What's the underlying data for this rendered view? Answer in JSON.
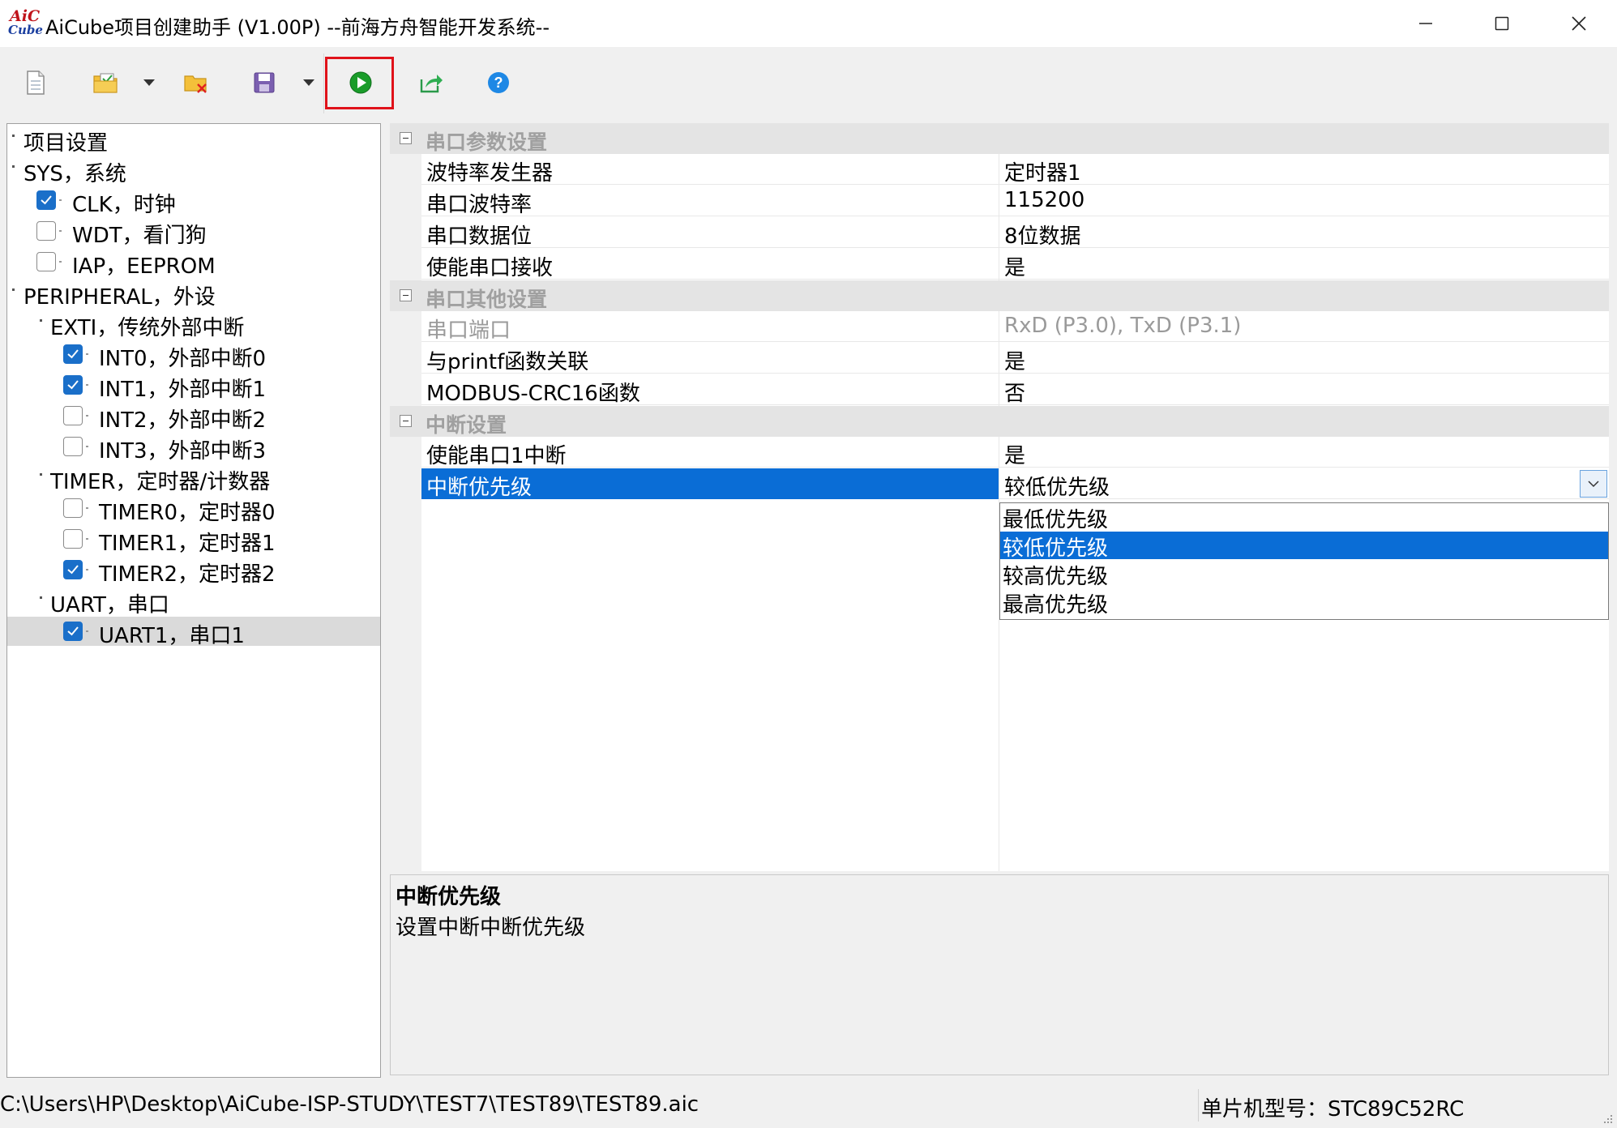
{
  "window": {
    "logo_top": "AiC",
    "logo_bottom": "Cube",
    "title": "AiCube项目创建助手 (V1.00P) --前海方舟智能开发系统--"
  },
  "toolbar": {
    "icons": [
      "new-file-icon",
      "open-project-icon",
      "close-project-icon",
      "save-icon",
      "run-icon",
      "export-icon",
      "help-icon"
    ],
    "accent_run": "#1a9c2a",
    "highlight_border": "#e0121a"
  },
  "tree": {
    "items": [
      {
        "label": "项目设置"
      },
      {
        "label": "SYS，系统"
      },
      {
        "label": "CLK，时钟",
        "checked": true
      },
      {
        "label": "WDT，看门狗",
        "checked": false
      },
      {
        "label": "IAP，EEPROM",
        "checked": false
      },
      {
        "label": "PERIPHERAL，外设"
      },
      {
        "label": "EXTI，传统外部中断"
      },
      {
        "label": "INT0，外部中断0",
        "checked": true
      },
      {
        "label": "INT1，外部中断1",
        "checked": true
      },
      {
        "label": "INT2，外部中断2",
        "checked": false
      },
      {
        "label": "INT3，外部中断3",
        "checked": false
      },
      {
        "label": "TIMER，定时器/计数器"
      },
      {
        "label": "TIMER0，定时器0",
        "checked": false
      },
      {
        "label": "TIMER1，定时器1",
        "checked": false
      },
      {
        "label": "TIMER2，定时器2",
        "checked": true
      },
      {
        "label": "UART，串口"
      },
      {
        "label": "UART1，串口1",
        "checked": true,
        "selected": true
      }
    ]
  },
  "grid": {
    "cat1": "串口参数设置",
    "baud_gen_name": "波特率发生器",
    "baud_gen_value": "定时器1",
    "baud_name": "串口波特率",
    "baud_value": "115200",
    "databits_name": "串口数据位",
    "databits_value": "8位数据",
    "rx_name": "使能串口接收",
    "rx_value": "是",
    "cat2": "串口其他设置",
    "port_name": "串口端口",
    "port_value": "RxD (P3.0), TxD (P3.1)",
    "printf_name": "与printf函数关联",
    "printf_value": "是",
    "crc_name": "MODBUS-CRC16函数",
    "crc_value": "否",
    "cat3": "中断设置",
    "int_enable_name": "使能串口1中断",
    "int_enable_value": "是",
    "priority_name": "中断优先级",
    "priority_value": "较低优先级"
  },
  "dropdown": {
    "options": [
      "最低优先级",
      "较低优先级",
      "较高优先级",
      "最高优先级"
    ],
    "selected_index": 1
  },
  "description": {
    "title": "中断优先级",
    "text": "设置中断中断优先级"
  },
  "statusbar": {
    "path": "C:\\Users\\HP\\Desktop\\AiCube-ISP-STUDY\\TEST7\\TEST89\\TEST89.aic",
    "mcu": "单片机型号：STC89C52RC"
  },
  "colors": {
    "selection": "#0a6dd6",
    "checkbox_on": "#1a6fc9"
  }
}
